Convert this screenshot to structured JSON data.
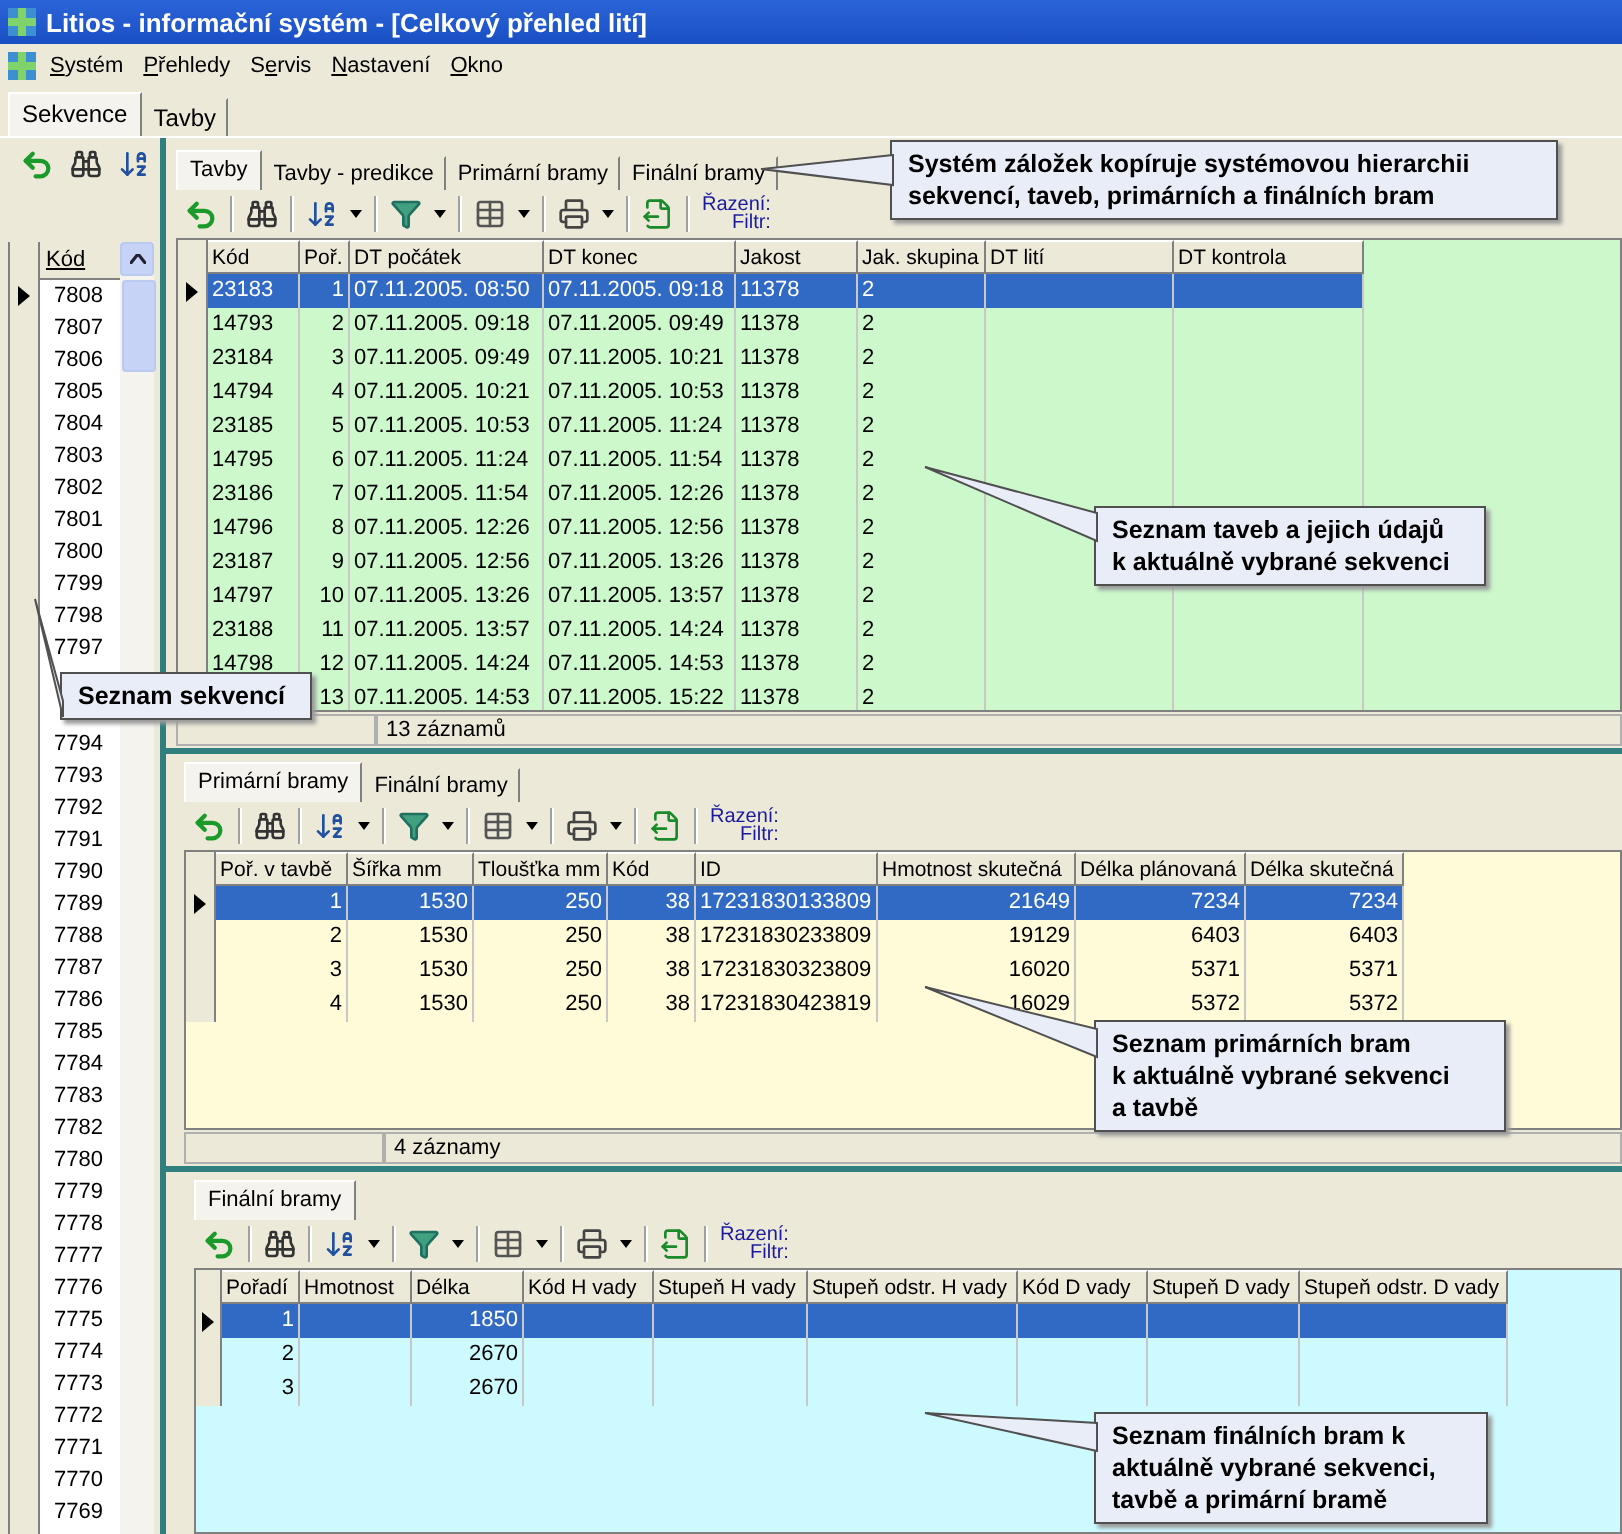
{
  "window": {
    "title": "Litios - informační systém - [Celkový přehled lití]"
  },
  "menu": [
    {
      "key": "S",
      "post": "ystém"
    },
    {
      "key": "P",
      "post": "řehledy"
    },
    {
      "pre": "S",
      "key": "e",
      "post": "rvis"
    },
    {
      "key": "N",
      "post": "astavení"
    },
    {
      "key": "O",
      "post": "kno"
    }
  ],
  "top_tabs": [
    {
      "label": "Sekvence",
      "selected": true
    },
    {
      "label": "Tavby",
      "selected": false
    }
  ],
  "sequences": {
    "header": "Kód",
    "items": [
      {
        "label": "7808",
        "selected": true
      },
      {
        "label": "7807",
        "selected": false
      },
      {
        "label": "7806",
        "selected": false
      },
      {
        "label": "7805",
        "selected": false
      },
      {
        "label": "7804",
        "selected": false
      },
      {
        "label": "7803",
        "selected": false
      },
      {
        "label": "7802",
        "selected": false
      },
      {
        "label": "7801",
        "selected": false
      },
      {
        "label": "7800",
        "selected": false
      },
      {
        "label": "7799",
        "selected": false
      },
      {
        "label": "7798",
        "selected": false
      },
      {
        "label": "7797",
        "selected": false
      },
      {
        "selected": false
      },
      {
        "selected": false
      },
      {
        "label": "7794",
        "selected": false
      },
      {
        "label": "7793",
        "selected": false
      },
      {
        "label": "7792",
        "selected": false
      },
      {
        "label": "7791",
        "selected": false
      },
      {
        "label": "7790",
        "selected": false
      },
      {
        "label": "7789",
        "selected": false
      },
      {
        "label": "7788",
        "selected": false
      },
      {
        "label": "7787",
        "selected": false
      },
      {
        "label": "7786",
        "selected": false
      },
      {
        "label": "7785",
        "selected": false
      },
      {
        "label": "7784",
        "selected": false
      },
      {
        "label": "7783",
        "selected": false
      },
      {
        "label": "7782",
        "selected": false
      },
      {
        "label": "7780",
        "selected": false
      },
      {
        "label": "7779",
        "selected": false
      },
      {
        "label": "7778",
        "selected": false
      },
      {
        "label": "7777",
        "selected": false
      },
      {
        "label": "7776",
        "selected": false
      },
      {
        "label": "7775",
        "selected": false
      },
      {
        "label": "7774",
        "selected": false
      },
      {
        "label": "7773",
        "selected": false
      },
      {
        "label": "7772",
        "selected": false
      },
      {
        "label": "7771",
        "selected": false
      },
      {
        "label": "7770",
        "selected": false
      },
      {
        "label": "7769",
        "selected": false
      }
    ]
  },
  "sections": [
    {
      "tabs": [
        {
          "label": "Tavby",
          "selected": true
        },
        {
          "label": "Tavby - predikce",
          "selected": false
        },
        {
          "label": "Primární bramy",
          "selected": false
        },
        {
          "label": "Finální bramy",
          "selected": false
        }
      ],
      "toolbar": {
        "sort_label": "Řazení:",
        "filter_label": "Filtr:"
      },
      "columns": [
        {
          "label": "Kód"
        },
        {
          "label": "Poř."
        },
        {
          "label": "DT počátek"
        },
        {
          "label": "DT konec"
        },
        {
          "label": "Jakost"
        },
        {
          "label": "Jak. skupina"
        },
        {
          "label": "DT lití"
        },
        {
          "label": "DT kontrola"
        }
      ],
      "rows": [
        {
          "selected": true,
          "cells": [
            "23183",
            "1",
            "07.11.2005. 08:50",
            "07.11.2005. 09:18",
            "11378",
            "2"
          ]
        },
        {
          "selected": false,
          "cells": [
            "14793",
            "2",
            "07.11.2005. 09:18",
            "07.11.2005. 09:49",
            "11378",
            "2"
          ]
        },
        {
          "selected": false,
          "cells": [
            "23184",
            "3",
            "07.11.2005. 09:49",
            "07.11.2005. 10:21",
            "11378",
            "2"
          ]
        },
        {
          "selected": false,
          "cells": [
            "14794",
            "4",
            "07.11.2005. 10:21",
            "07.11.2005. 10:53",
            "11378",
            "2"
          ]
        },
        {
          "selected": false,
          "cells": [
            "23185",
            "5",
            "07.11.2005. 10:53",
            "07.11.2005. 11:24",
            "11378",
            "2"
          ]
        },
        {
          "selected": false,
          "cells": [
            "14795",
            "6",
            "07.11.2005. 11:24",
            "07.11.2005. 11:54",
            "11378",
            "2"
          ]
        },
        {
          "selected": false,
          "cells": [
            "23186",
            "7",
            "07.11.2005. 11:54",
            "07.11.2005. 12:26",
            "11378",
            "2"
          ]
        },
        {
          "selected": false,
          "cells": [
            "14796",
            "8",
            "07.11.2005. 12:26",
            "07.11.2005. 12:56",
            "11378",
            "2"
          ]
        },
        {
          "selected": false,
          "cells": [
            "23187",
            "9",
            "07.11.2005. 12:56",
            "07.11.2005. 13:26",
            "11378",
            "2"
          ]
        },
        {
          "selected": false,
          "cells": [
            "14797",
            "10",
            "07.11.2005. 13:26",
            "07.11.2005. 13:57",
            "11378",
            "2"
          ]
        },
        {
          "selected": false,
          "cells": [
            "23188",
            "11",
            "07.11.2005. 13:57",
            "07.11.2005. 14:24",
            "11378",
            "2"
          ]
        },
        {
          "selected": false,
          "cells": [
            "14798",
            "12",
            "07.11.2005. 14:24",
            "07.11.2005. 14:53",
            "11378",
            "2"
          ]
        },
        {
          "selected": false,
          "cells": [
            null,
            "13",
            "07.11.2005. 14:53",
            "07.11.2005. 15:22",
            "11378",
            "2"
          ]
        }
      ],
      "status": "13 záznamů"
    },
    {
      "tabs": [
        {
          "label": "Primární bramy",
          "selected": true
        },
        {
          "label": "Finální bramy",
          "selected": false
        }
      ],
      "toolbar": {
        "sort_label": "Řazení:",
        "filter_label": "Filtr:"
      },
      "columns": [
        {
          "label": "Poř. v tavbě"
        },
        {
          "label": "Šířka mm"
        },
        {
          "label": "Tloušťka mm"
        },
        {
          "label": "Kód"
        },
        {
          "label": "ID"
        },
        {
          "label": "Hmotnost skutečná"
        },
        {
          "label": "Délka plánovaná"
        },
        {
          "label": "Délka skutečná"
        }
      ],
      "rows": [
        {
          "selected": true,
          "cells": [
            "1",
            "1530",
            "250",
            "38",
            "17231830133809",
            "21649",
            "7234",
            "7234"
          ]
        },
        {
          "selected": false,
          "cells": [
            "2",
            "1530",
            "250",
            "38",
            "17231830233809",
            "19129",
            "6403",
            "6403"
          ]
        },
        {
          "selected": false,
          "cells": [
            "3",
            "1530",
            "250",
            "38",
            "17231830323809",
            "16020",
            "5371",
            "5371"
          ]
        },
        {
          "selected": false,
          "cells": [
            "4",
            "1530",
            "250",
            "38",
            "17231830423819",
            "16029",
            "5372",
            "5372"
          ]
        }
      ],
      "status": "4 záznamy"
    },
    {
      "tabs": [
        {
          "label": "Finální bramy",
          "selected": true
        }
      ],
      "toolbar": {
        "sort_label": "Řazení:",
        "filter_label": "Filtr:"
      },
      "columns": [
        {
          "label": "Pořadí"
        },
        {
          "label": "Hmotnost"
        },
        {
          "label": "Délka"
        },
        {
          "label": "Kód H vady"
        },
        {
          "label": "Stupeň H vady"
        },
        {
          "label": "Stupeň odstr. H vady"
        },
        {
          "label": "Kód D vady"
        },
        {
          "label": "Stupeň D vady"
        },
        {
          "label": "Stupeň odstr. D vady"
        }
      ],
      "rows": [
        {
          "selected": true,
          "cells": [
            "1",
            null,
            "1850"
          ]
        },
        {
          "selected": false,
          "cells": [
            "2",
            null,
            "2670"
          ]
        },
        {
          "selected": false,
          "cells": [
            "3",
            null,
            "2670"
          ]
        }
      ]
    }
  ],
  "callouts": [
    {
      "text": "Systém záložek kopíruje systémovou hierarchii\nsekvencí, taveb, primárních a finálních bram"
    },
    {
      "text": "Seznam taveb a jejich údajů\nk aktuálně vybrané sekvenci"
    },
    {
      "text": "Seznam primárních bram\nk aktuálně vybrané sekvenci\na tavbě"
    },
    {
      "text": "Seznam finálních bram k\naktuálně vybrané sekvenci,\ntavbě a primární bramě"
    },
    {
      "text": "Seznam sekvencí"
    }
  ]
}
